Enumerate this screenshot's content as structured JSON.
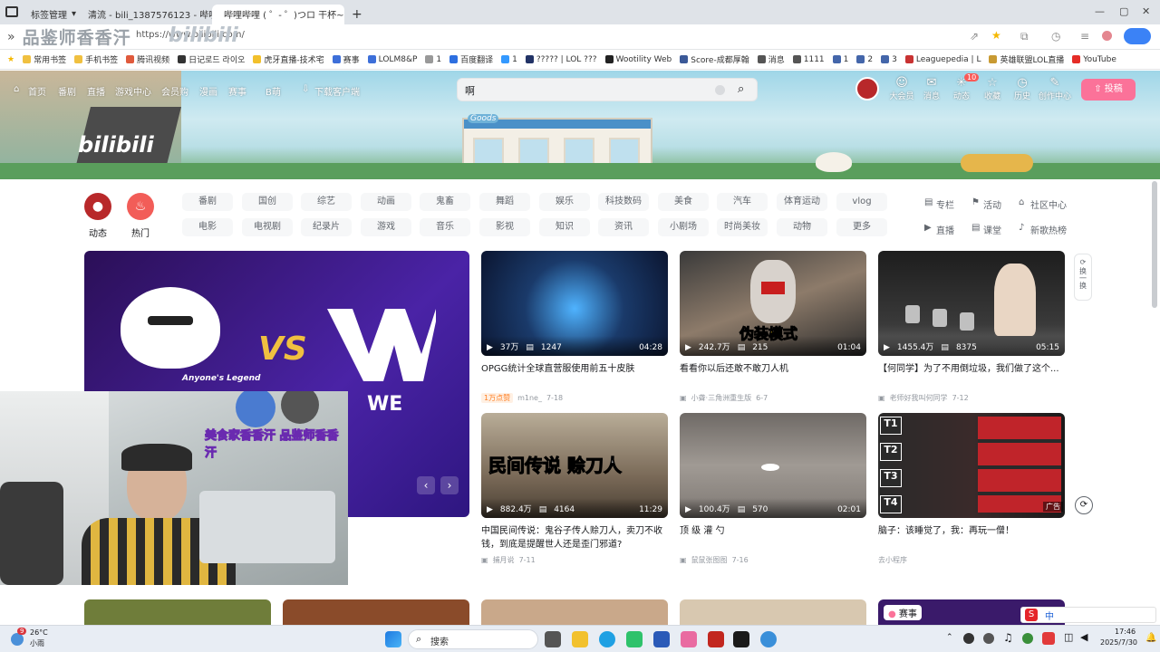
{
  "browser": {
    "tabs": [
      {
        "label": "标签管理",
        "active": false
      },
      {
        "label": "清流 - bili_1387576123 - 哔哩",
        "active": false
      },
      {
        "label": "哔哩哔哩 ( ゜- ゜)つロ 干杯~-",
        "active": true
      }
    ],
    "new_tab": "+",
    "url": "https://www.bilibili.com/",
    "watermark_left": "品鉴师香香汗",
    "watermark_right": "bilibili",
    "bookmarks": [
      "常用书签",
      "手机书签",
      "腾讯视频",
      "日记로드 라이오",
      "虎牙直播-技术宅",
      "赛事",
      "LOLM8&P",
      "1",
      "百度翻译",
      "1",
      "????? | LOL ???",
      "Wootility Web",
      "Score-成都厚翰",
      "消息",
      "1111",
      "1",
      "2",
      "3",
      "Leaguepedia | L",
      "英雄联盟LOL直播",
      "YouTube"
    ]
  },
  "bili": {
    "nav": [
      "首页",
      "番剧",
      "直播",
      "游戏中心",
      "会员购",
      "漫画",
      "赛事",
      "B萌",
      "下载客户端"
    ],
    "search_value": "啊",
    "right_nav": [
      {
        "label": "大会员",
        "icon": "☺"
      },
      {
        "label": "消息",
        "icon": "✉"
      },
      {
        "label": "动态",
        "icon": "✳",
        "badge": "10"
      },
      {
        "label": "收藏",
        "icon": "☆"
      },
      {
        "label": "历史",
        "icon": "◷"
      },
      {
        "label": "创作中心",
        "icon": "✎"
      }
    ],
    "upload": "投稿",
    "logo": "bilibili",
    "store_sign": "Goods",
    "round_buttons": [
      {
        "label": "动态",
        "color": "#b8282a"
      },
      {
        "label": "热门",
        "color": "#f25d58"
      }
    ],
    "channels_row1": [
      "番剧",
      "国创",
      "综艺",
      "动画",
      "鬼畜",
      "舞蹈",
      "娱乐",
      "科技数码",
      "美食",
      "汽车",
      "体育运动",
      "vlog"
    ],
    "channels_row2": [
      "电影",
      "电视剧",
      "纪录片",
      "游戏",
      "音乐",
      "影视",
      "知识",
      "资讯",
      "小剧场",
      "时尚美妆",
      "动物",
      "更多"
    ],
    "side_links_row1": [
      "专栏",
      "活动",
      "社区中心"
    ],
    "side_links_row2": [
      "直播",
      "课堂",
      "新歌热榜"
    ],
    "refresh": "换一换",
    "hero": {
      "team_left": "Anyone's Legend",
      "vs": "VS",
      "team_right": "WE"
    },
    "cards": [
      {
        "title": "OPGG统计全球直营服使用前五十皮肤",
        "plays": "37万",
        "danmaku": "1247",
        "duration": "04:28",
        "badge": "1万点赞",
        "author": "m1ne_",
        "date": "7-18",
        "bg": "#1a3a6a"
      },
      {
        "title": "看看你以后还敢不敢刀人机",
        "plays": "242.7万",
        "danmaku": "215",
        "duration": "01:04",
        "badge": "",
        "author": "小聋·三角洲重生版",
        "date": "6-7",
        "bg": "#6b5a4a",
        "overlay": "伪装模式"
      },
      {
        "title": "【何同学】为了不用倒垃圾，我们做了这个...",
        "plays": "1455.4万",
        "danmaku": "8375",
        "duration": "05:15",
        "badge": "",
        "author": "老师好我叫何同学",
        "date": "7-12",
        "bg": "#2b2b2b"
      },
      {
        "title": "中国民间传说：鬼谷子传人赊刀人，卖刀不收钱，到底是提醒世人还是歪门邪道?",
        "plays": "882.4万",
        "danmaku": "4164",
        "duration": "11:29",
        "badge": "",
        "author": "捕月说",
        "date": "7-11",
        "bg": "#7a6a58",
        "overlay": "民间传说 赊刀人"
      },
      {
        "title": "顶 级 灌 勺",
        "plays": "100.4万",
        "danmaku": "570",
        "duration": "02:01",
        "badge": "",
        "author": "鼠鼠张图图",
        "date": "7-16",
        "bg": "#8a8580"
      },
      {
        "title": "脑子：该睡觉了，我：再玩一僧！",
        "plays": "",
        "danmaku": "",
        "duration": "",
        "badge": "",
        "author": "去小程序",
        "date": "",
        "bg": "#2a2a2a",
        "ad": "广告"
      }
    ],
    "webcam_text": "美食家香香汗 品鉴师香香汗",
    "bottom_badge": "赛事"
  },
  "taskbar": {
    "weather_temp": "26°C",
    "weather_desc": "小雨",
    "weather_badge": "9",
    "search": "搜索",
    "time": "17:46",
    "date": "2025/7/30",
    "ime": "中"
  }
}
